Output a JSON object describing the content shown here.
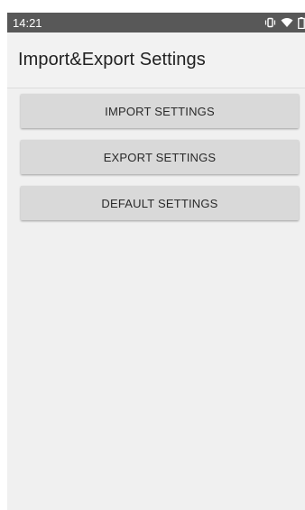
{
  "status_bar": {
    "time": "14:21",
    "icons": [
      "vibrate-icon",
      "wifi-icon",
      "battery-icon"
    ]
  },
  "action_bar": {
    "title": "Import&Export Settings"
  },
  "buttons": [
    {
      "label": "IMPORT SETTINGS"
    },
    {
      "label": "EXPORT SETTINGS"
    },
    {
      "label": "DEFAULT SETTINGS"
    }
  ],
  "colors": {
    "status_bar_bg": "#585858",
    "app_bg": "#f0f0f0",
    "button_bg": "#d9d9d9"
  }
}
